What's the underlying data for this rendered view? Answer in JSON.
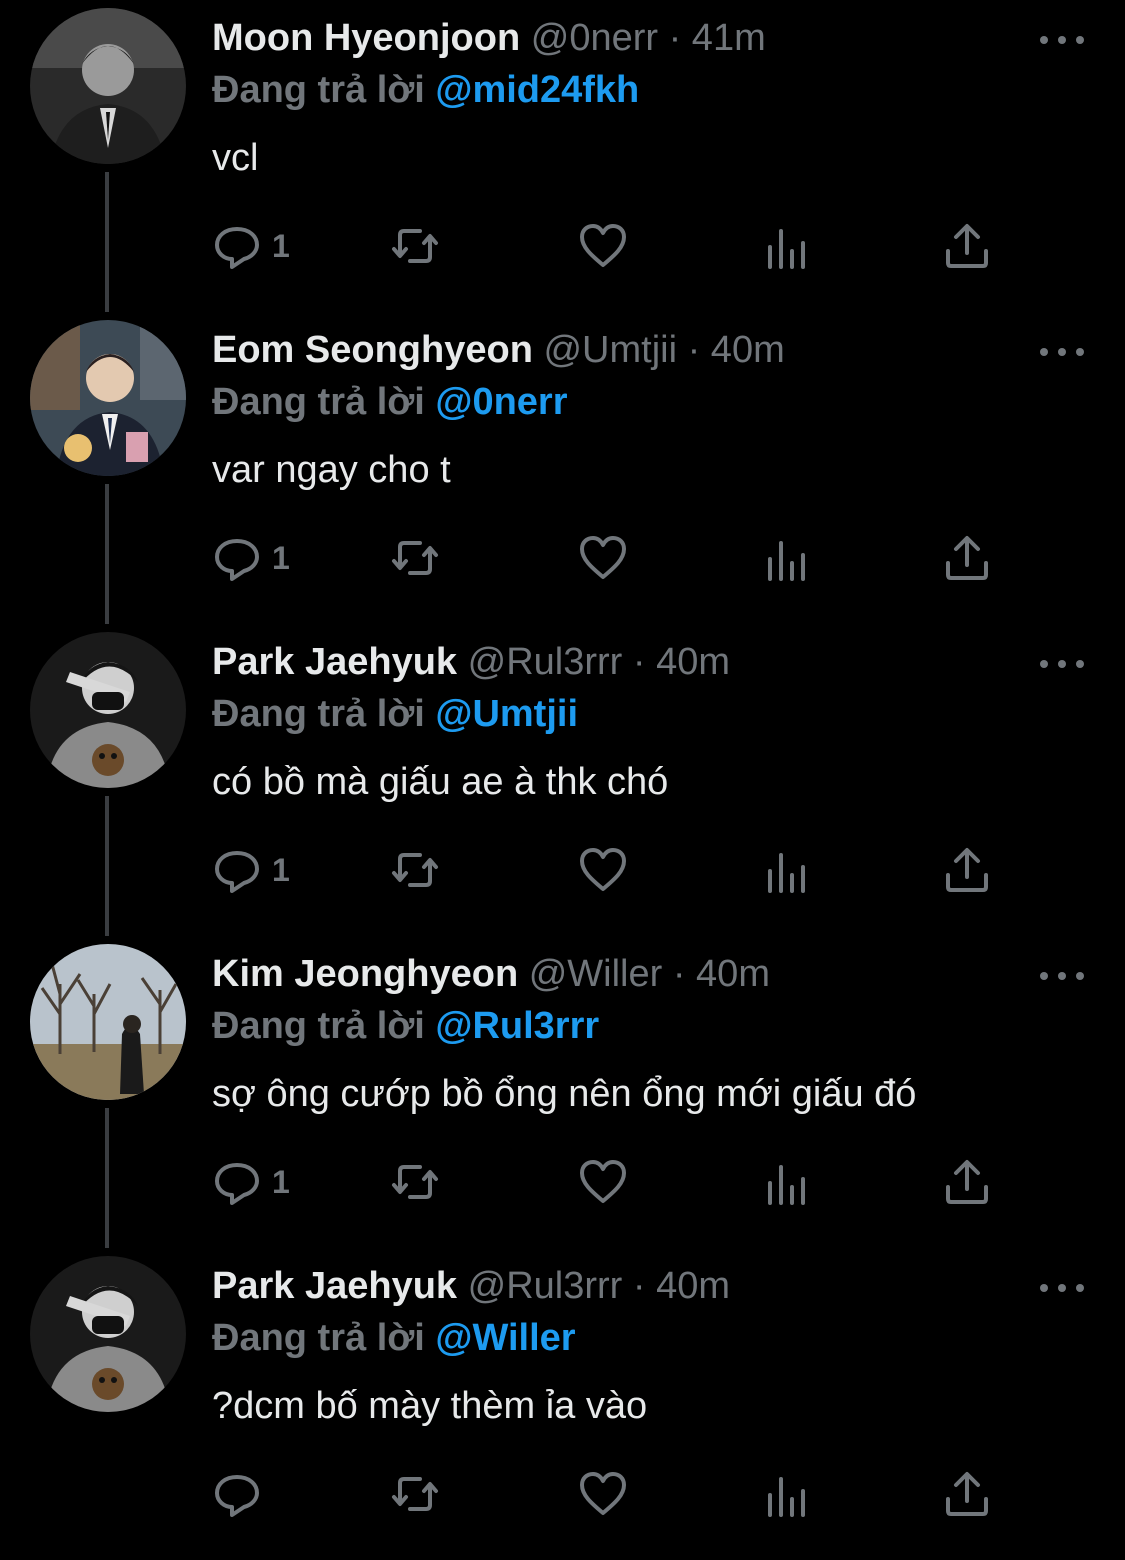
{
  "reply_prefix": "Đang trả lời",
  "colors": {
    "background": "#000000",
    "text": "#e7e9ea",
    "muted": "#71767b",
    "accent": "#1d9bf0",
    "thread_line": "#3a3d41"
  },
  "icons": [
    "reply-icon",
    "retweet-icon",
    "like-icon",
    "views-icon",
    "share-icon",
    "more-icon"
  ],
  "tweets": [
    {
      "name": "Moon Hyeonjoon",
      "meta": "@0nerr · 41m",
      "reply_to": "@mid24fkh",
      "text": "vcl",
      "reply_count": "1"
    },
    {
      "name": "Eom Seonghyeon",
      "meta": "@Umtjii · 40m",
      "reply_to": "@0nerr",
      "text": "var ngay cho t",
      "reply_count": "1"
    },
    {
      "name": "Park Jaehyuk",
      "meta": "@Rul3rrr · 40m",
      "reply_to": "@Umtjii",
      "text": "có bồ mà giấu ae à thk chó",
      "reply_count": "1"
    },
    {
      "name": "Kim Jeonghyeon",
      "meta": "@Willer · 40m",
      "reply_to": "@Rul3rrr",
      "text": "sợ ông cướp bồ ổng nên ổng mới giấu đó",
      "reply_count": "1"
    },
    {
      "name": "Park Jaehyuk",
      "meta": "@Rul3rrr · 40m",
      "reply_to": "@Willer",
      "text": "?dcm bố mày thèm ỉa vào",
      "reply_count": ""
    }
  ]
}
